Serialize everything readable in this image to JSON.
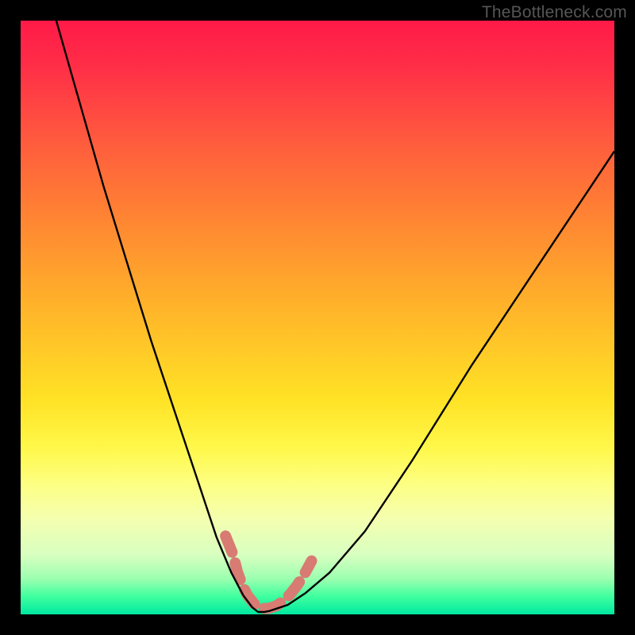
{
  "watermark": "TheBottleneck.com",
  "chart_data": {
    "type": "line",
    "title": "",
    "xlabel": "",
    "ylabel": "",
    "xlim": [
      0,
      100
    ],
    "ylim": [
      0,
      100
    ],
    "series": [
      {
        "name": "bottleneck-curve",
        "x": [
          6,
          10,
          14,
          18,
          22,
          26,
          30,
          33,
          35.5,
          37.5,
          39,
          40,
          41,
          42,
          45,
          48,
          52,
          58,
          66,
          76,
          88,
          100
        ],
        "y": [
          100,
          86,
          72,
          59,
          46,
          34,
          22,
          13,
          7,
          3.2,
          1.2,
          0.4,
          0.4,
          0.6,
          1.6,
          3.6,
          7,
          14,
          26,
          42,
          60,
          78
        ]
      },
      {
        "name": "dashed-highlight",
        "x": [
          34.5,
          35.8,
          36.5,
          37.3,
          38.2,
          39.3,
          40.5,
          41.7,
          43.0,
          44.2,
          45.4,
          46.5,
          47.7,
          49.0
        ],
        "y": [
          13.2,
          10.0,
          7.2,
          5.0,
          3.2,
          1.8,
          1.0,
          1.0,
          1.4,
          2.2,
          3.4,
          4.8,
          6.6,
          9.0
        ]
      }
    ],
    "gradient_stops": [
      {
        "pos": 0,
        "color": "#ff1a48"
      },
      {
        "pos": 40,
        "color": "#ff9a2e"
      },
      {
        "pos": 72,
        "color": "#fff84a"
      },
      {
        "pos": 100,
        "color": "#00e8a0"
      }
    ]
  }
}
